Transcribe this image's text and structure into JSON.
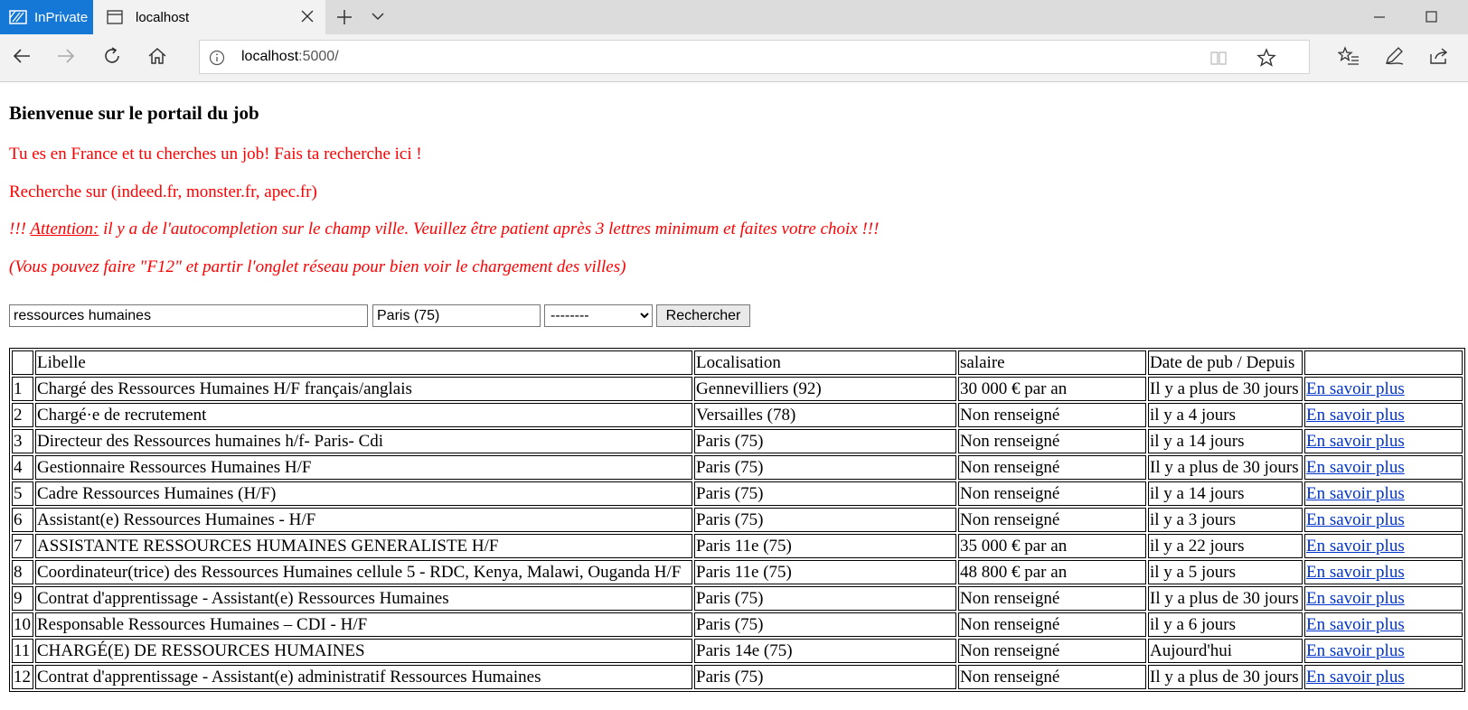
{
  "browser": {
    "inprivate_label": "InPrivate",
    "tab_title": "localhost",
    "url_host": "localhost",
    "url_rest": ":5000/"
  },
  "page": {
    "heading": "Bienvenue sur le portail du job",
    "line1": "Tu es en France et tu cherches un job! Fais ta recherche ici !",
    "line2": "Recherche sur (indeed.fr, monster.fr, apec.fr)",
    "attention_prefix": "!!! ",
    "attention_label": "Attention:",
    "attention_text": " il y a de l'autocompletion sur le champ ville. Veuillez être patient après 3 lettres minimum et faites votre choix !!!",
    "line4": "(Vous pouvez faire \"F12\" et partir l'onglet réseau pour bien voir le chargement des villes)"
  },
  "search": {
    "keyword_value": "ressources humaines",
    "city_value": "Paris (75)",
    "select_value": "--------",
    "button_label": "Rechercher"
  },
  "table": {
    "headers": [
      "",
      "Libelle",
      "Localisation",
      "salaire",
      "Date de pub / Depuis",
      ""
    ],
    "link_label": "En savoir plus",
    "rows": [
      [
        "1",
        "Chargé des Ressources Humaines H/F français/anglais",
        "Gennevilliers (92)",
        "30 000 € par an",
        "Il y a plus de 30 jours"
      ],
      [
        "2",
        "Chargé·e de recrutement",
        "Versailles (78)",
        "Non renseigné",
        "il y a 4 jours"
      ],
      [
        "3",
        "Directeur des Ressources humaines h/f- Paris- Cdi",
        "Paris (75)",
        "Non renseigné",
        "il y a 14 jours"
      ],
      [
        "4",
        "Gestionnaire Ressources Humaines H/F",
        "Paris (75)",
        "Non renseigné",
        "Il y a plus de 30 jours"
      ],
      [
        "5",
        "Cadre Ressources Humaines (H/F)",
        "Paris (75)",
        "Non renseigné",
        "il y a 14 jours"
      ],
      [
        "6",
        "Assistant(e) Ressources Humaines - H/F",
        "Paris (75)",
        "Non renseigné",
        "il y a 3 jours"
      ],
      [
        "7",
        "ASSISTANTE RESSOURCES HUMAINES GENERALISTE H/F",
        "Paris 11e (75)",
        "35 000 € par an",
        "il y a 22 jours"
      ],
      [
        "8",
        "Coordinateur(trice) des Ressources Humaines cellule 5 - RDC, Kenya, Malawi, Ouganda H/F",
        "Paris 11e (75)",
        "48 800 € par an",
        "il y a 5 jours"
      ],
      [
        "9",
        "Contrat d'apprentissage - Assistant(e) Ressources Humaines",
        "Paris (75)",
        "Non renseigné",
        "Il y a plus de 30 jours"
      ],
      [
        "10",
        "Responsable Ressources Humaines – CDI - H/F",
        "Paris (75)",
        "Non renseigné",
        "il y a 6 jours"
      ],
      [
        "11",
        "CHARGÉ(E) DE RESSOURCES HUMAINES",
        "Paris 14e (75)",
        "Non renseigné",
        "Aujourd'hui"
      ],
      [
        "12",
        "Contrat d'apprentissage - Assistant(e) administratif Ressources Humaines",
        "Paris (75)",
        "Non renseigné",
        "Il y a plus de 30 jours"
      ]
    ]
  },
  "colors": {
    "inprivate_blue": "#1577d6",
    "message_red": "#ff0000",
    "link_blue": "#0033cc"
  }
}
